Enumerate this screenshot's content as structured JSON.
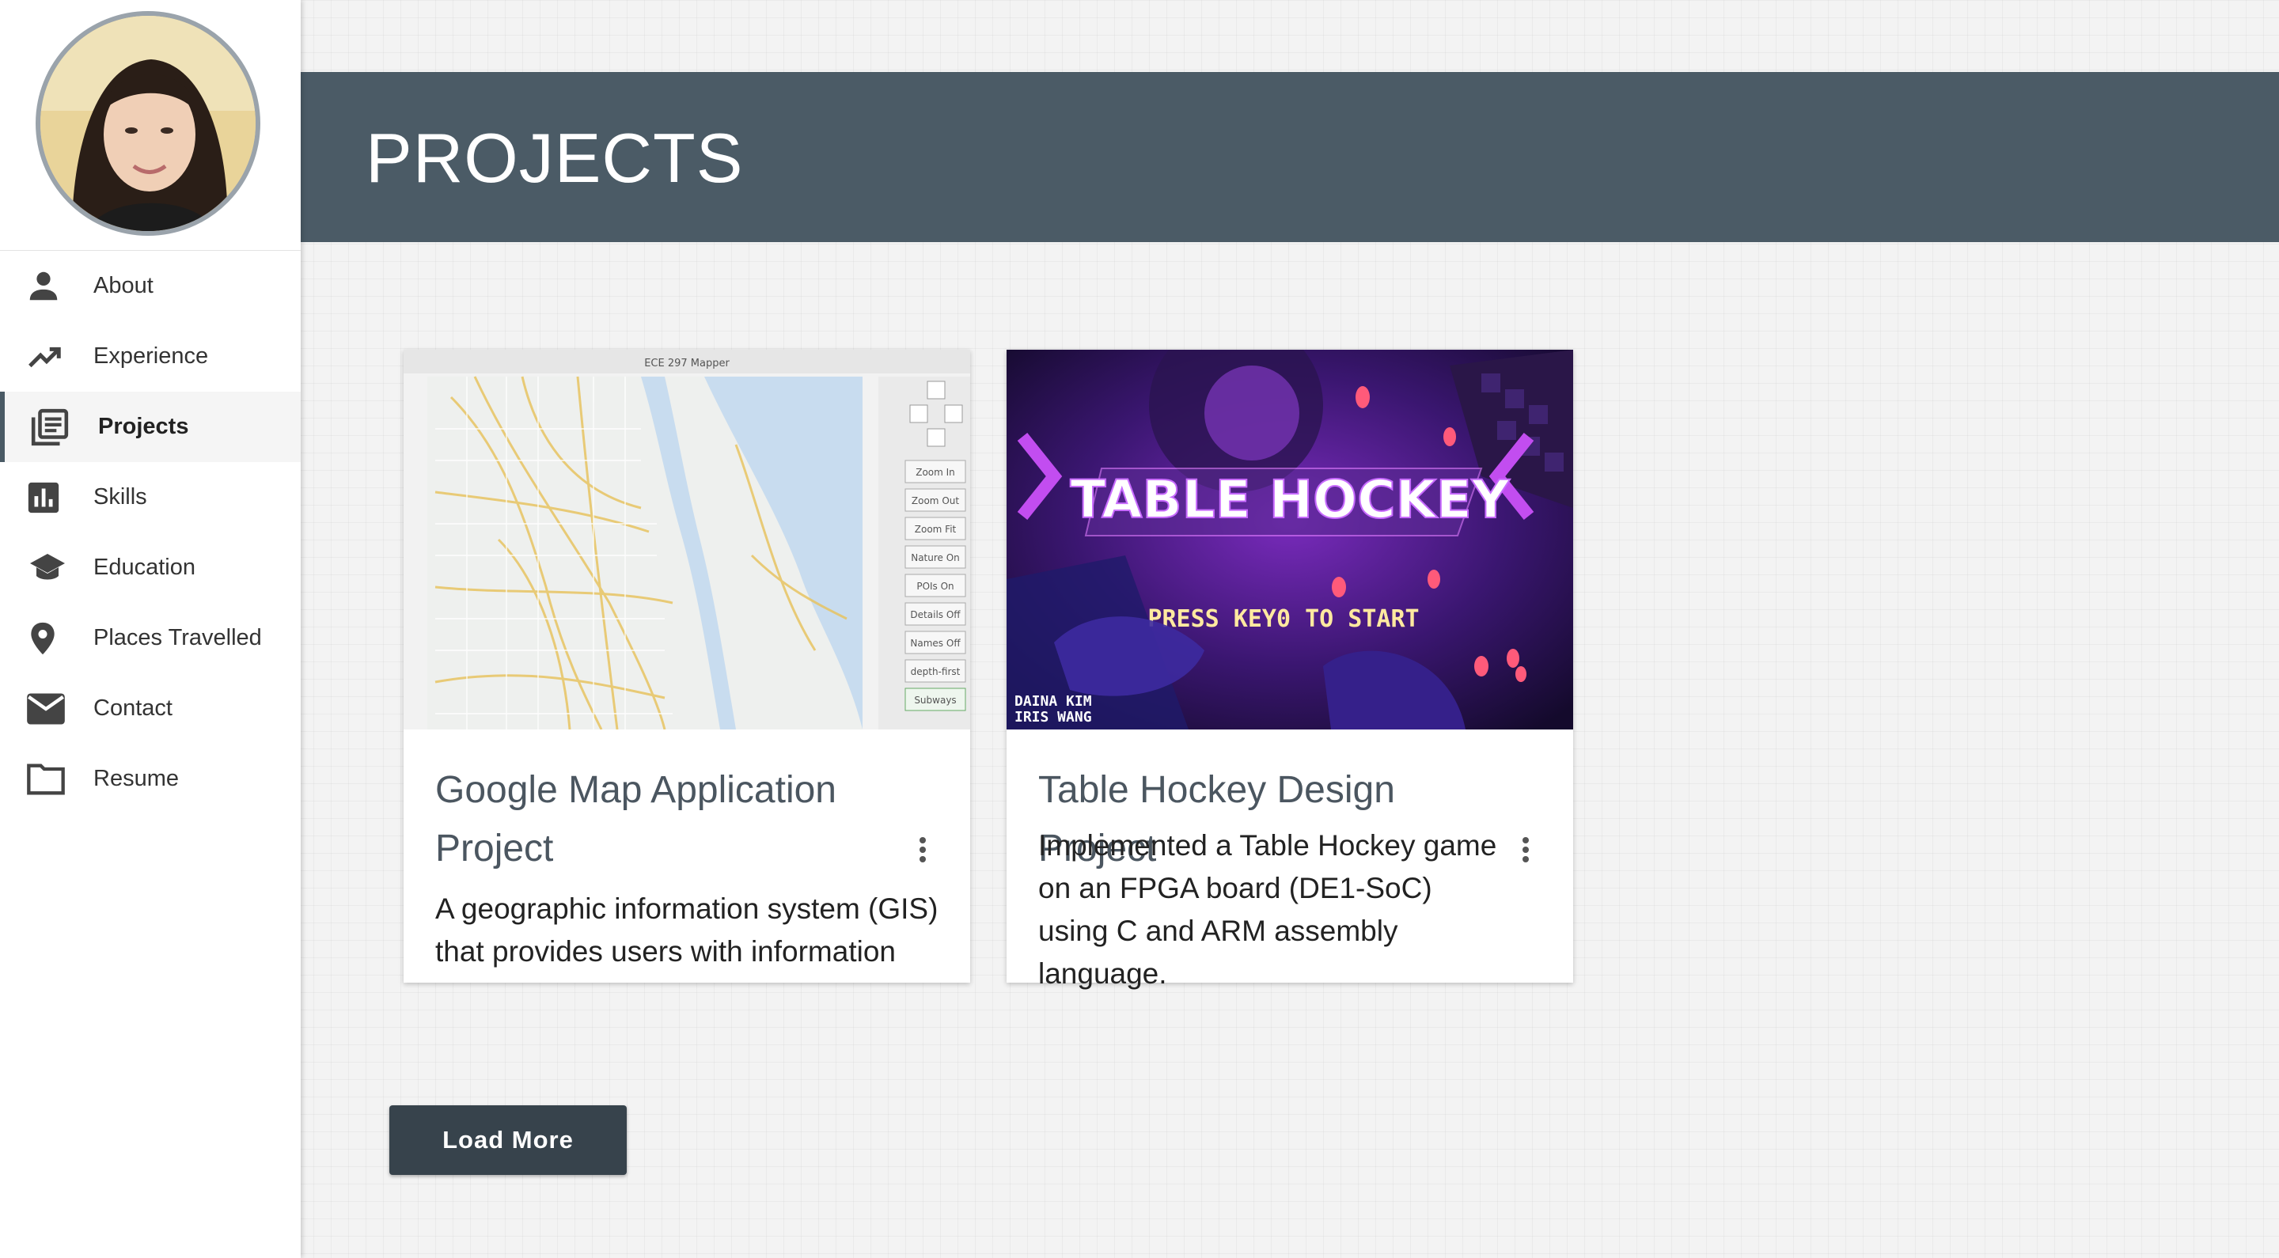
{
  "sidebar": {
    "items": [
      {
        "label": "About",
        "icon": "person-icon"
      },
      {
        "label": "Experience",
        "icon": "trending-up-icon"
      },
      {
        "label": "Projects",
        "icon": "article-icon",
        "active": true
      },
      {
        "label": "Skills",
        "icon": "bar-chart-icon"
      },
      {
        "label": "Education",
        "icon": "graduation-cap-icon"
      },
      {
        "label": "Places Travelled",
        "icon": "map-pin-icon"
      },
      {
        "label": "Contact",
        "icon": "envelope-icon"
      },
      {
        "label": "Resume",
        "icon": "folder-icon"
      }
    ]
  },
  "header": {
    "title": "PROJECTS"
  },
  "projects": [
    {
      "title": "Google Map Application Project",
      "description": "A geographic information system (GIS) that provides users with information",
      "image": {
        "window_title": "ECE 297 Mapper",
        "controls": [
          "Zoom In",
          "Zoom Out",
          "Zoom Fit",
          "Nature On",
          "POIs On",
          "Details Off",
          "Names Off",
          "depth-first",
          "Subways"
        ]
      }
    },
    {
      "title": "Table Hockey Design Project",
      "description": "Implemented a Table Hockey game on an FPGA board (DE1-SoC) using C and ARM assembly language.",
      "image": {
        "game_title": "TABLE HOCKEY",
        "prompt": "PRESS KEY0 TO START",
        "credits": [
          "DAINA KIM",
          "IRIS WANG"
        ]
      }
    }
  ],
  "load_more_label": "Load More",
  "colors": {
    "header_bg": "#4b5b66",
    "button_bg": "#37434c",
    "sidebar_bg": "#ffffff"
  }
}
